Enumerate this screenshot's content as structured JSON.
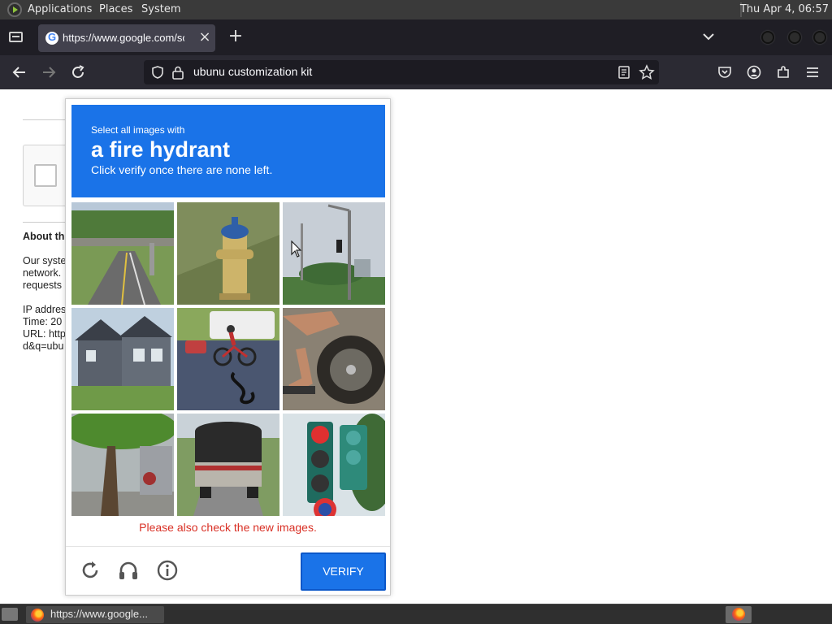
{
  "system_bar": {
    "menu": [
      "Applications",
      "Places",
      "System"
    ],
    "clock": "Thu Apr  4, 06:57"
  },
  "browser": {
    "tab_title": "https://www.google.com/sorry/index?continue",
    "tab_close": "×",
    "new_tab": "+",
    "address": "ubunu customization kit"
  },
  "page": {
    "heading": "About th",
    "lines": [
      "Our syste",
      "network.",
      "requests"
    ],
    "ip_line": "IP addres",
    "time_line": "Time: 20",
    "url_line": "URL: http",
    "url_line2": "d&q=ubu"
  },
  "captcha": {
    "subtitle": "Select all images with",
    "object": "a fire hydrant",
    "instruction": "Click verify once there are none left.",
    "tiles": [
      {
        "desc": "road overpass",
        "icon": "road-overpass-image"
      },
      {
        "desc": "fire hydrant",
        "icon": "fire-hydrant-image"
      },
      {
        "desc": "street lights",
        "icon": "street-light-image"
      },
      {
        "desc": "houses",
        "icon": "houses-image"
      },
      {
        "desc": "cyclist",
        "icon": "cyclist-image"
      },
      {
        "desc": "motorcycle",
        "icon": "motorcycle-image"
      },
      {
        "desc": "tree",
        "icon": "tree-image"
      },
      {
        "desc": "truck",
        "icon": "truck-image"
      },
      {
        "desc": "traffic light",
        "icon": "traffic-light-image"
      }
    ],
    "message": "Please also check the new images.",
    "verify_label": "VERIFY",
    "primary_color": "#1a73e8",
    "error_color": "#d93025"
  },
  "taskbar": {
    "window_label": "https://www.google..."
  }
}
